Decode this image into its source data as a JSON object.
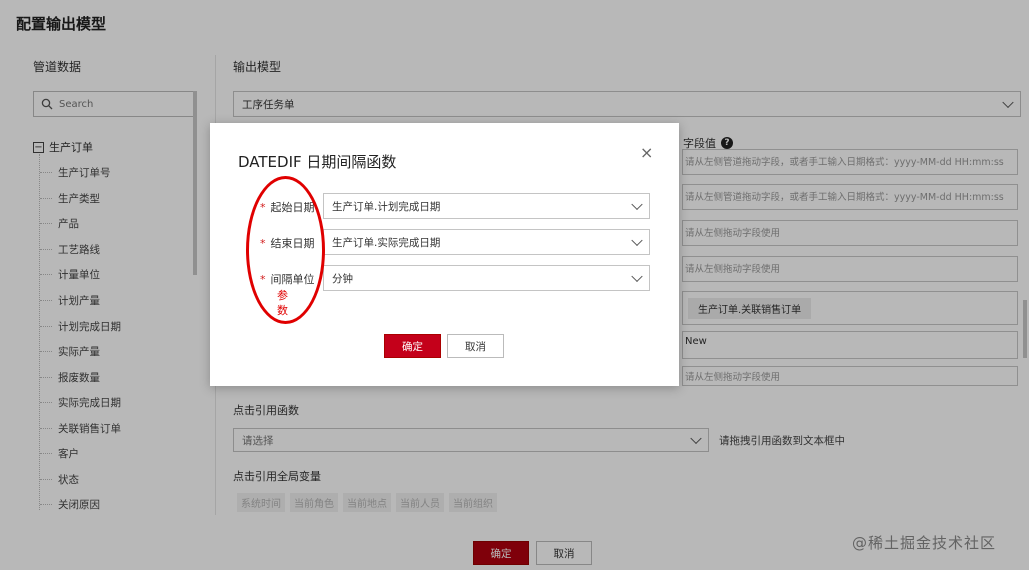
{
  "page": {
    "title": "配置输出模型"
  },
  "left": {
    "heading": "管道数据",
    "search_placeholder": "Search",
    "tree_root": "生产订单",
    "items": [
      "生产订单号",
      "生产类型",
      "产品",
      "工艺路线",
      "计量单位",
      "计划产量",
      "计划完成日期",
      "实际产量",
      "报废数量",
      "实际完成日期",
      "关联销售订单",
      "客户",
      "状态",
      "关闭原因"
    ]
  },
  "right": {
    "heading": "输出模型",
    "model_select": "工序任务单",
    "field_value_header": "字段值",
    "fields": [
      "请从左侧管道拖动字段，或者手工输入日期格式：yyyy-MM-dd HH:mm:ss",
      "请从左侧管道拖动字段，或者手工输入日期格式：yyyy-MM-dd HH:mm:ss",
      "请从左侧拖动字段使用",
      "请从左侧拖动字段使用",
      "",
      "New",
      "请从左侧拖动字段使用"
    ],
    "field_tag": "生产订单.关联销售订单",
    "func_label": "点击引用函数",
    "func_placeholder": "请选择",
    "func_hint": "请拖拽引用函数到文本框中",
    "vars_label": "点击引用全局变量",
    "vars": [
      "系统时间",
      "当前角色",
      "当前地点",
      "当前人员",
      "当前组织"
    ]
  },
  "footer": {
    "ok": "确定",
    "cancel": "取消"
  },
  "modal": {
    "title": "DATEDIF 日期间隔函数",
    "close": "×",
    "rows": [
      {
        "label": "起始日期",
        "value": "生产订单.计划完成日期"
      },
      {
        "label": "结束日期",
        "value": "生产订单.实际完成日期"
      },
      {
        "label": "间隔单位",
        "value": "分钟"
      }
    ],
    "required_mark": "*",
    "ok": "确定",
    "cancel": "取消"
  },
  "annotation": {
    "text": "参数",
    "color": "#e00000"
  },
  "watermark": "@稀土掘金技术社区",
  "colors": {
    "primary": "#c4001a"
  }
}
